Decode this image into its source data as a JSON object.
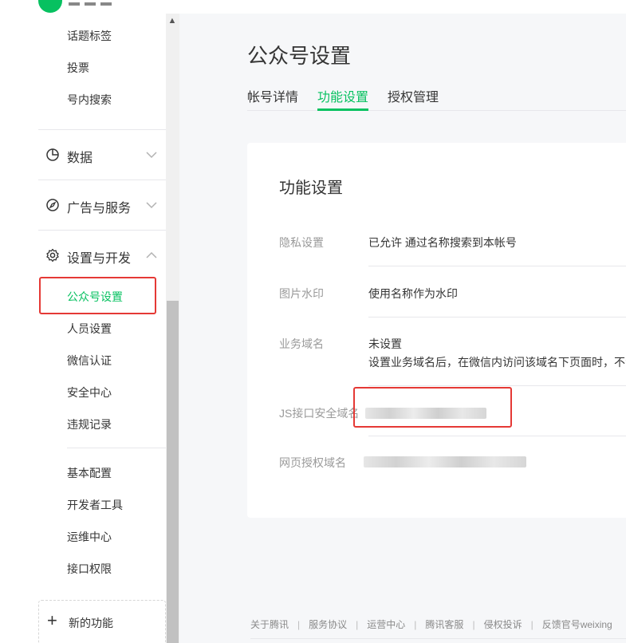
{
  "sidebar": {
    "top_subitems": [
      "话题标签",
      "投票",
      "号内搜索"
    ],
    "groups": {
      "data": "数据",
      "ads": "广告与服务",
      "settings": "设置与开发"
    },
    "settings_items": [
      "公众号设置",
      "人员设置",
      "微信认证",
      "安全中心",
      "违规记录"
    ],
    "dev_items": [
      "基本配置",
      "开发者工具",
      "运维中心",
      "接口权限"
    ],
    "new_feature": "新的功能"
  },
  "main": {
    "title": "公众号设置",
    "tabs": [
      "帐号详情",
      "功能设置",
      "授权管理"
    ],
    "active_tab": "功能设置",
    "card": {
      "title": "功能设置",
      "rows": [
        {
          "label": "隐私设置",
          "value": "已允许 通过名称搜索到本帐号"
        },
        {
          "label": "图片水印",
          "value": "使用名称作为水印"
        },
        {
          "label": "业务域名",
          "value": "未设置",
          "note": "设置业务域名后，在微信内访问该域名下页面时，不会"
        },
        {
          "label": "JS接口安全域名",
          "value": ""
        },
        {
          "label": "网页授权域名",
          "value": ""
        }
      ]
    }
  },
  "footer": {
    "links": [
      "关于腾讯",
      "服务协议",
      "运营中心",
      "腾讯客服",
      "侵权投诉",
      "反馈官号weixing"
    ]
  },
  "colors": {
    "accent": "#07c160",
    "highlight_box": "#e53935"
  }
}
